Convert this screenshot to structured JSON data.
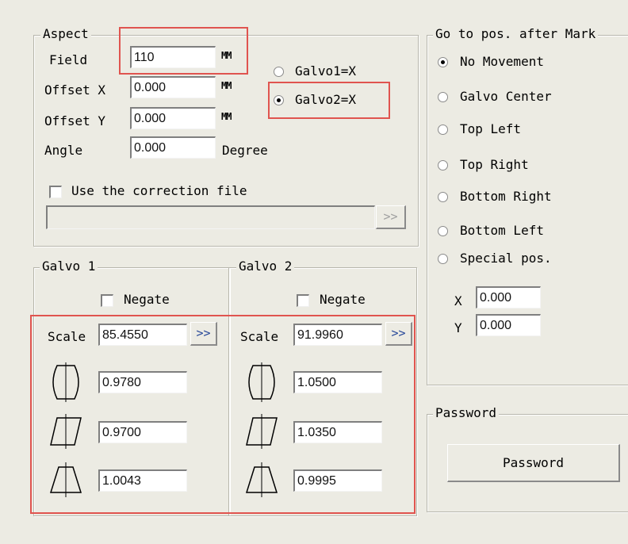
{
  "aspect": {
    "legend": "Aspect",
    "field_label": "Field",
    "field_value": "110",
    "field_unit": "MM",
    "offset_x_label": "Offset X",
    "offset_x_value": "0.000",
    "offset_x_unit": "MM",
    "offset_y_label": "Offset Y",
    "offset_y_value": "0.000",
    "offset_y_unit": "MM",
    "angle_label": "Angle",
    "angle_value": "0.000",
    "angle_unit": "Degree",
    "galvo1x_label": "Galvo1=X",
    "galvo2x_label": "Galvo2=X",
    "galvo_axis_selected": "Galvo2=X",
    "use_correction_label": "Use the correction file",
    "use_correction_checked": false,
    "correction_path": "",
    "browse_label": ">>"
  },
  "galvo1": {
    "legend": "Galvo 1",
    "negate_label": "Negate",
    "negate_checked": false,
    "scale_label": "Scale",
    "scale_value": "85.4550",
    "scale_btn": ">>",
    "barrel_value": "0.9780",
    "parallelogram_value": "0.9700",
    "trapezoid_value": "1.0043"
  },
  "galvo2": {
    "legend": "Galvo 2",
    "negate_label": "Negate",
    "negate_checked": false,
    "scale_label": "Scale",
    "scale_value": "91.9960",
    "scale_btn": ">>",
    "barrel_value": "1.0500",
    "parallelogram_value": "1.0350",
    "trapezoid_value": "0.9995"
  },
  "goto": {
    "legend": "Go to pos. after Mark",
    "options": [
      "No Movement",
      "Galvo Center",
      "Top Left",
      "Top Right",
      "Bottom Right",
      "Bottom Left",
      "Special pos."
    ],
    "selected": "No Movement",
    "x_label": "X",
    "x_value": "0.000",
    "y_label": "Y",
    "y_value": "0.000"
  },
  "password": {
    "legend": "Password",
    "button_label": "Password"
  },
  "icons": {
    "barrel": "barrel-distortion-icon",
    "parallelogram": "parallelogram-distortion-icon",
    "trapezoid": "trapezoid-distortion-icon"
  },
  "colors": {
    "background": "#ecebe3",
    "highlight": "#e0544f",
    "arrow": "#2a4a9a"
  }
}
